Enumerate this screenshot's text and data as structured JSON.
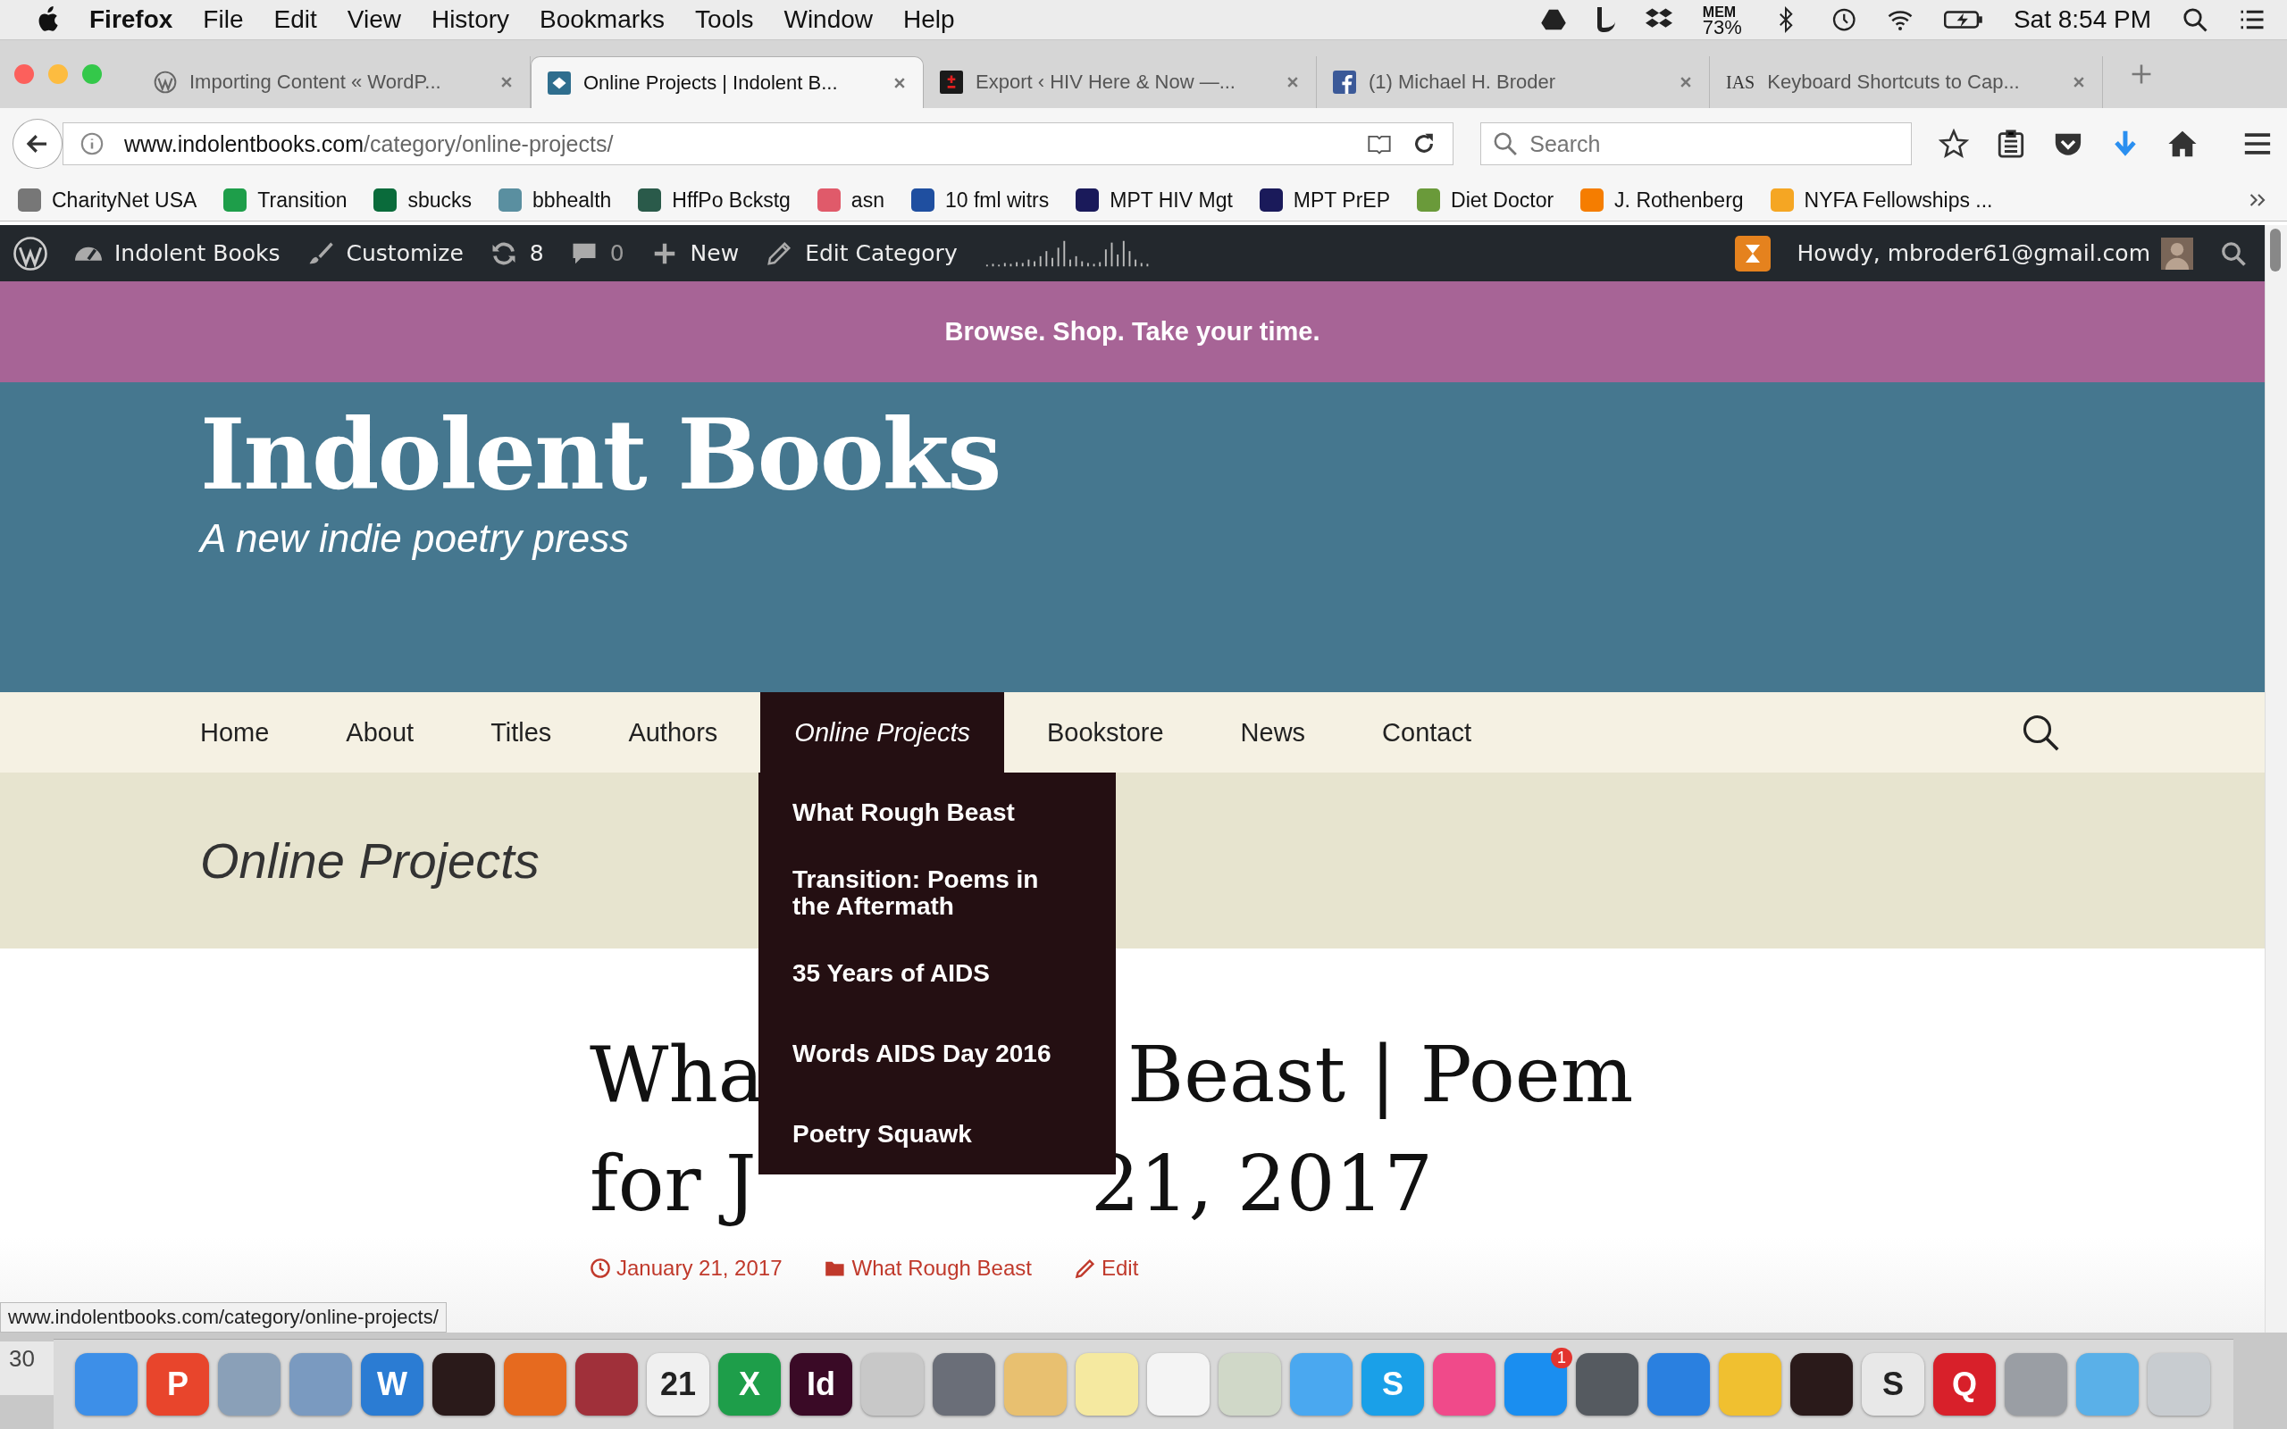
{
  "menu_bar": {
    "app": "Firefox",
    "menus": [
      "File",
      "Edit",
      "View",
      "History",
      "Bookmarks",
      "Tools",
      "Window",
      "Help"
    ],
    "mem_label": "MEM",
    "mem_value": "73%",
    "clock": "Sat 8:54 PM"
  },
  "tabs": [
    {
      "title": "Importing Content « WordP...",
      "selected": false,
      "kind": "wordpress"
    },
    {
      "title": "Online Projects | Indolent B...",
      "selected": true,
      "kind": "site"
    },
    {
      "title": "Export ‹ HIV Here & Now —...",
      "selected": false,
      "kind": "plusminus"
    },
    {
      "title": "(1) Michael H. Broder",
      "selected": false,
      "kind": "facebook"
    },
    {
      "title": "Keyboard Shortcuts to Cap...",
      "selected": false,
      "kind": "text",
      "favicon_text": "IAS"
    }
  ],
  "url": {
    "host": "www.indolentbooks.com",
    "path": "/category/online-projects/"
  },
  "search": {
    "placeholder": "Search"
  },
  "bookmarks": [
    {
      "label": "CharityNet USA",
      "color": "#777777"
    },
    {
      "label": "Transition",
      "color": "#1e9e4a"
    },
    {
      "label": "sbucks",
      "color": "#0a6b3b"
    },
    {
      "label": "bbhealth",
      "color": "#5a8fa0"
    },
    {
      "label": "HffPo Bckstg",
      "color": "#2a5a4a"
    },
    {
      "label": "asn",
      "color": "#e05a6a"
    },
    {
      "label": "10 fml witrs",
      "color": "#1f4fa0"
    },
    {
      "label": "MPT HIV Mgt",
      "color": "#1a1a5a"
    },
    {
      "label": "MPT PrEP",
      "color": "#1a1a5a"
    },
    {
      "label": "Diet Doctor",
      "color": "#6a9a3a"
    },
    {
      "label": "J. Rothenberg",
      "color": "#f57d00"
    },
    {
      "label": "NYFA Fellowships ...",
      "color": "#f5a623"
    }
  ],
  "admin_bar": {
    "items": [
      {
        "kind": "site",
        "label": "Indolent Books"
      },
      {
        "kind": "customize",
        "label": "Customize"
      },
      {
        "kind": "updates",
        "label": "8"
      },
      {
        "kind": "comments",
        "label": "0"
      },
      {
        "kind": "new",
        "label": "New"
      },
      {
        "kind": "edit",
        "label": "Edit Category"
      }
    ],
    "howdy": "Howdy, mbroder61@gmail.com"
  },
  "banner": "Browse. Shop. Take your time.",
  "site": {
    "title": "Indolent Books",
    "tagline": "A new indie poetry press"
  },
  "nav": [
    {
      "label": "Home",
      "selected": false
    },
    {
      "label": "About",
      "selected": false
    },
    {
      "label": "Titles",
      "selected": false
    },
    {
      "label": "Authors",
      "selected": false
    },
    {
      "label": "Online Projects",
      "selected": true
    },
    {
      "label": "Bookstore",
      "selected": false
    },
    {
      "label": "News",
      "selected": false
    },
    {
      "label": "Contact",
      "selected": false
    }
  ],
  "dropdown": [
    "What Rough Beast",
    "Transition: Poems in the Aftermath",
    "35 Years of AIDS",
    "Words AIDS Day 2016",
    "Poetry Squawk"
  ],
  "page_title": "Online Projects",
  "post": {
    "title_lines": [
      [
        "Wha",
        "Beast | Poem"
      ],
      [
        "for J",
        "21, 2017"
      ]
    ],
    "date": "January 21, 2017",
    "category": "What Rough Beast",
    "edit": "Edit"
  },
  "status_url": "www.indolentbooks.com/category/online-projects/",
  "calendar_peek": "30",
  "dock": [
    {
      "color": "#3d8fe8"
    },
    {
      "color": "#e8452c",
      "label": "P"
    },
    {
      "color": "#8aa0b8"
    },
    {
      "color": "#7a9ac0"
    },
    {
      "color": "#2b7cd3",
      "label": "W"
    },
    {
      "color": "#2a1a1a"
    },
    {
      "color": "#e66a1f"
    },
    {
      "color": "#a0303a"
    },
    {
      "color": "#f0f0f0",
      "label": "21"
    },
    {
      "color": "#1e9e4a",
      "label": "X"
    },
    {
      "color": "#3a0a26",
      "label": "Id"
    },
    {
      "color": "#c8c8c8"
    },
    {
      "color": "#6a6e78"
    },
    {
      "color": "#e8c070"
    },
    {
      "color": "#f5e9a0"
    },
    {
      "color": "#f4f4f4"
    },
    {
      "color": "#d0d8c8"
    },
    {
      "color": "#4aa8f0"
    },
    {
      "color": "#1aa0e8",
      "label": "S"
    },
    {
      "color": "#f04a8a"
    },
    {
      "color": "#1a8ef0"
    },
    {
      "color": "#555a60"
    },
    {
      "color": "#2a80e0"
    },
    {
      "color": "#f0c030"
    },
    {
      "color": "#2a1a1a"
    },
    {
      "color": "#e8e8e8",
      "label": "S"
    },
    {
      "color": "#d8202a",
      "label": "Q"
    },
    {
      "color": "#9a9ea4"
    },
    {
      "color": "#5ab0e8"
    },
    {
      "color": "#c8ccd0"
    }
  ],
  "dock_badge": "1"
}
